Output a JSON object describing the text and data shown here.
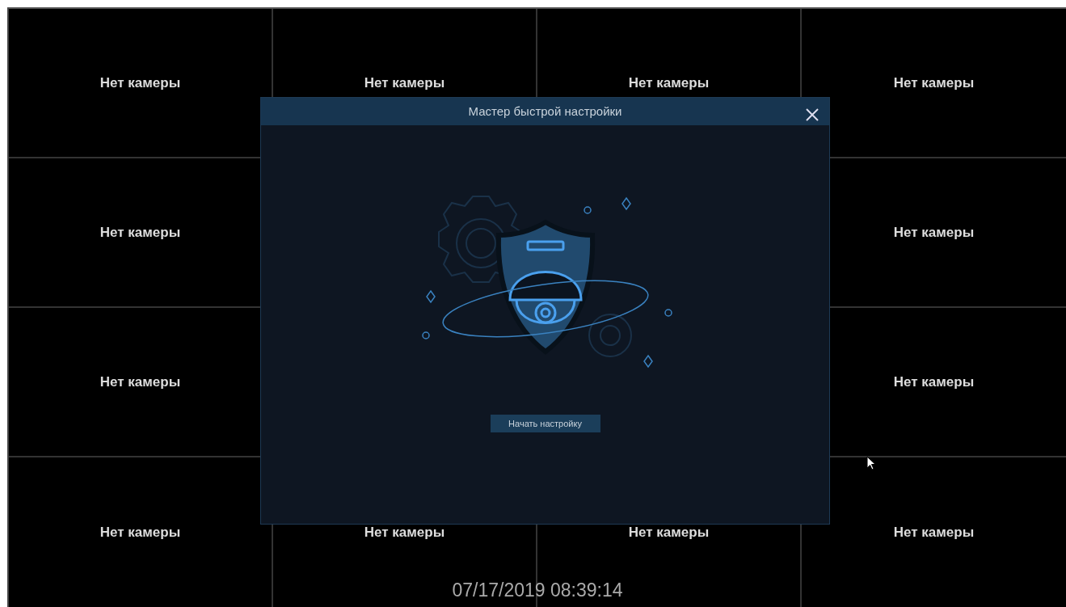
{
  "tiles": [
    {
      "label": "Нет камеры"
    },
    {
      "label": "Нет камеры"
    },
    {
      "label": "Нет камеры"
    },
    {
      "label": "Нет камеры"
    },
    {
      "label": "Нет камеры"
    },
    {
      "label": "Нет камеры"
    },
    {
      "label": "Нет камеры"
    },
    {
      "label": "Нет камеры"
    },
    {
      "label": "Нет камеры"
    },
    {
      "label": "Нет камеры"
    },
    {
      "label": "Нет камеры"
    },
    {
      "label": "Нет камеры"
    }
  ],
  "dialog": {
    "title": "Мастер быстрой настройки",
    "button": "Начать настройку"
  },
  "timestamp": "07/17/2019 08:39:14"
}
